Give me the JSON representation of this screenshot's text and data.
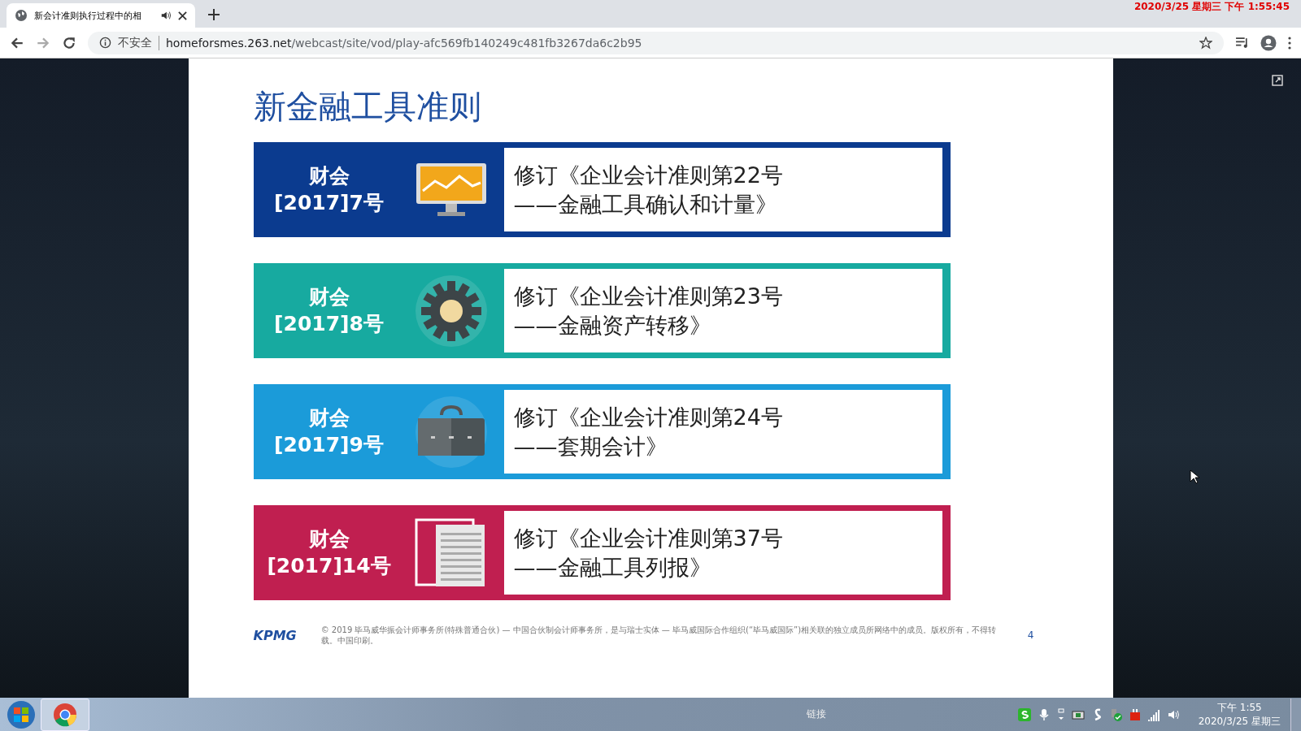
{
  "browser": {
    "tab": {
      "title": "新会计准则执行过程中的相"
    },
    "url": {
      "security": "不安全",
      "host": "homeforsmes.263.net",
      "path": "/webcast/site/vod/play-afc569fb140249c481fb3267da6c2b95"
    },
    "overlay_clock": "2020/3/25  星期三  下午 1:55:45"
  },
  "slide": {
    "title": "新金融工具准则",
    "cards": [
      {
        "code": [
          "财会",
          "[2017]7号"
        ],
        "kind": "monitor",
        "color": "#0b3b8f",
        "lines": [
          "修订《企业会计准则第22号",
          "——金融工具确认和计量》"
        ]
      },
      {
        "code": [
          "财会",
          "[2017]8号"
        ],
        "kind": "gear",
        "color": "#17aaa0",
        "lines": [
          "修订《企业会计准则第23号",
          "——金融资产转移》"
        ]
      },
      {
        "code": [
          "财会",
          "[2017]9号"
        ],
        "kind": "briefcase",
        "color": "#1b9bd9",
        "lines": [
          "修订《企业会计准则第24号",
          "——套期会计》"
        ]
      },
      {
        "code": [
          "财会",
          "[2017]14号"
        ],
        "kind": "document",
        "color": "#c01f50",
        "lines": [
          "修订《企业会计准则第37号",
          "——金融工具列报》"
        ]
      }
    ],
    "logo": "KPMG",
    "footer": "© 2019 毕马威华振会计师事务所(特殊普通合伙) — 中国合伙制会计师事务所，是与瑞士实体 — 毕马威国际合作组织(“毕马威国际”)相关联的独立成员所网络中的成员。版权所有，不得转载。中国印刷。",
    "page": "4"
  },
  "taskbar": {
    "toolbar": "链接",
    "time": "下午 1:55",
    "date": "2020/3/25 星期三"
  }
}
